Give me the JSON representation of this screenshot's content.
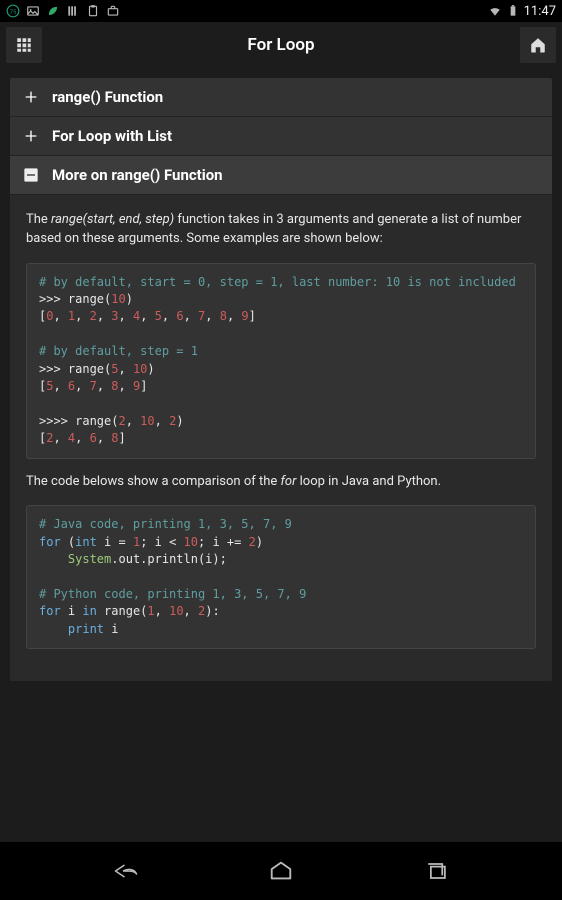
{
  "status_bar": {
    "time": "11:47"
  },
  "app_bar": {
    "title": "For Loop"
  },
  "sections": {
    "s0": {
      "title": "range() Function"
    },
    "s1": {
      "title": "For Loop with List"
    },
    "s2": {
      "title": "More on range() Function"
    }
  },
  "body": {
    "intro_pre": "The ",
    "intro_em": "range(start, end, step)",
    "intro_post": " function takes in 3 arguments and generate a list of number based on these arguments. Some examples are shown below:",
    "code1": {
      "c1": "# by default, start = 0, step = 1, last number: 10 is not included",
      "l2a": ">>> range(",
      "l2n": "10",
      "l2b": ")",
      "l3": "[0, 1, 2, 3, 4, 5, 6, 7, 8, 9]",
      "c4": "# by default, step = 1",
      "l5a": ">>> range(",
      "l5n1": "5",
      "l5c": ", ",
      "l5n2": "10",
      "l5b": ")",
      "l6": "[5, 6, 7, 8, 9]",
      "l7a": ">>>> range(",
      "l7n1": "2",
      "l7c1": ", ",
      "l7n2": "10",
      "l7c2": ", ",
      "l7n3": "2",
      "l7b": ")",
      "l8": "[2, 4, 6, 8]"
    },
    "mid_pre": "The code belows show a comparison of the ",
    "mid_em": "for",
    "mid_post": " loop in Java and Python.",
    "code2": {
      "c1": "# Java code, printing 1, 3, 5, 7, 9",
      "l2_for": "for",
      "l2_a": " (",
      "l2_int": "int",
      "l2_b": " i = ",
      "l2_n1": "1",
      "l2_c": "; i < ",
      "l2_n2": "10",
      "l2_d": "; i += ",
      "l2_n3": "2",
      "l2_e": ")",
      "l3_sys": "System",
      "l3_a": ".out.println(i);",
      "c4": "# Python code, printing 1, 3, 5, 7, 9",
      "l5_for": "for",
      "l5_a": " i ",
      "l5_in": "in",
      "l5_b": " range(",
      "l5_n1": "1",
      "l5_c1": ", ",
      "l5_n2": "10",
      "l5_c2": ", ",
      "l5_n3": "2",
      "l5_d": "):",
      "l6_print": "print",
      "l6_a": " i"
    }
  }
}
